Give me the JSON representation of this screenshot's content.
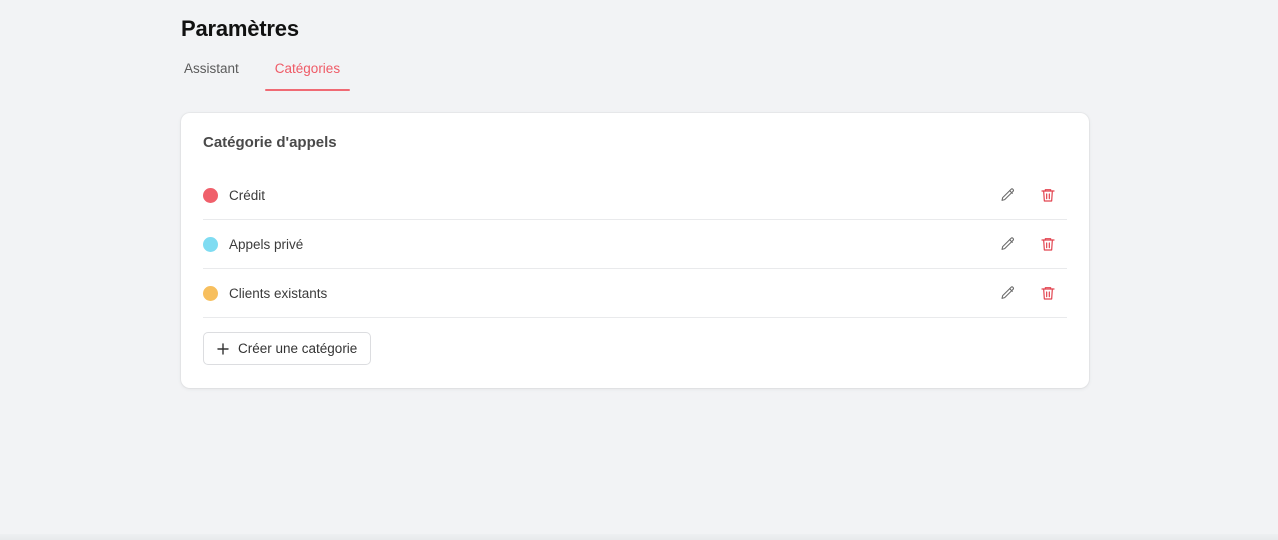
{
  "page": {
    "title": "Paramètres"
  },
  "tabs": [
    {
      "label": "Assistant",
      "active": false
    },
    {
      "label": "Catégories",
      "active": true
    }
  ],
  "card": {
    "title": "Catégorie d'appels",
    "categories": [
      {
        "label": "Crédit",
        "color": "#f0606b"
      },
      {
        "label": "Appels privé",
        "color": "#7fdcf2"
      },
      {
        "label": "Clients existants",
        "color": "#f7bf5e"
      }
    ],
    "create_label": "Créer une catégorie"
  },
  "icons": {
    "edit": "pencil-icon",
    "delete": "trash-icon",
    "add": "plus-icon"
  },
  "colors": {
    "accent": "#ef5a66",
    "delete": "#e2434f",
    "edit": "#6b6b6b"
  }
}
